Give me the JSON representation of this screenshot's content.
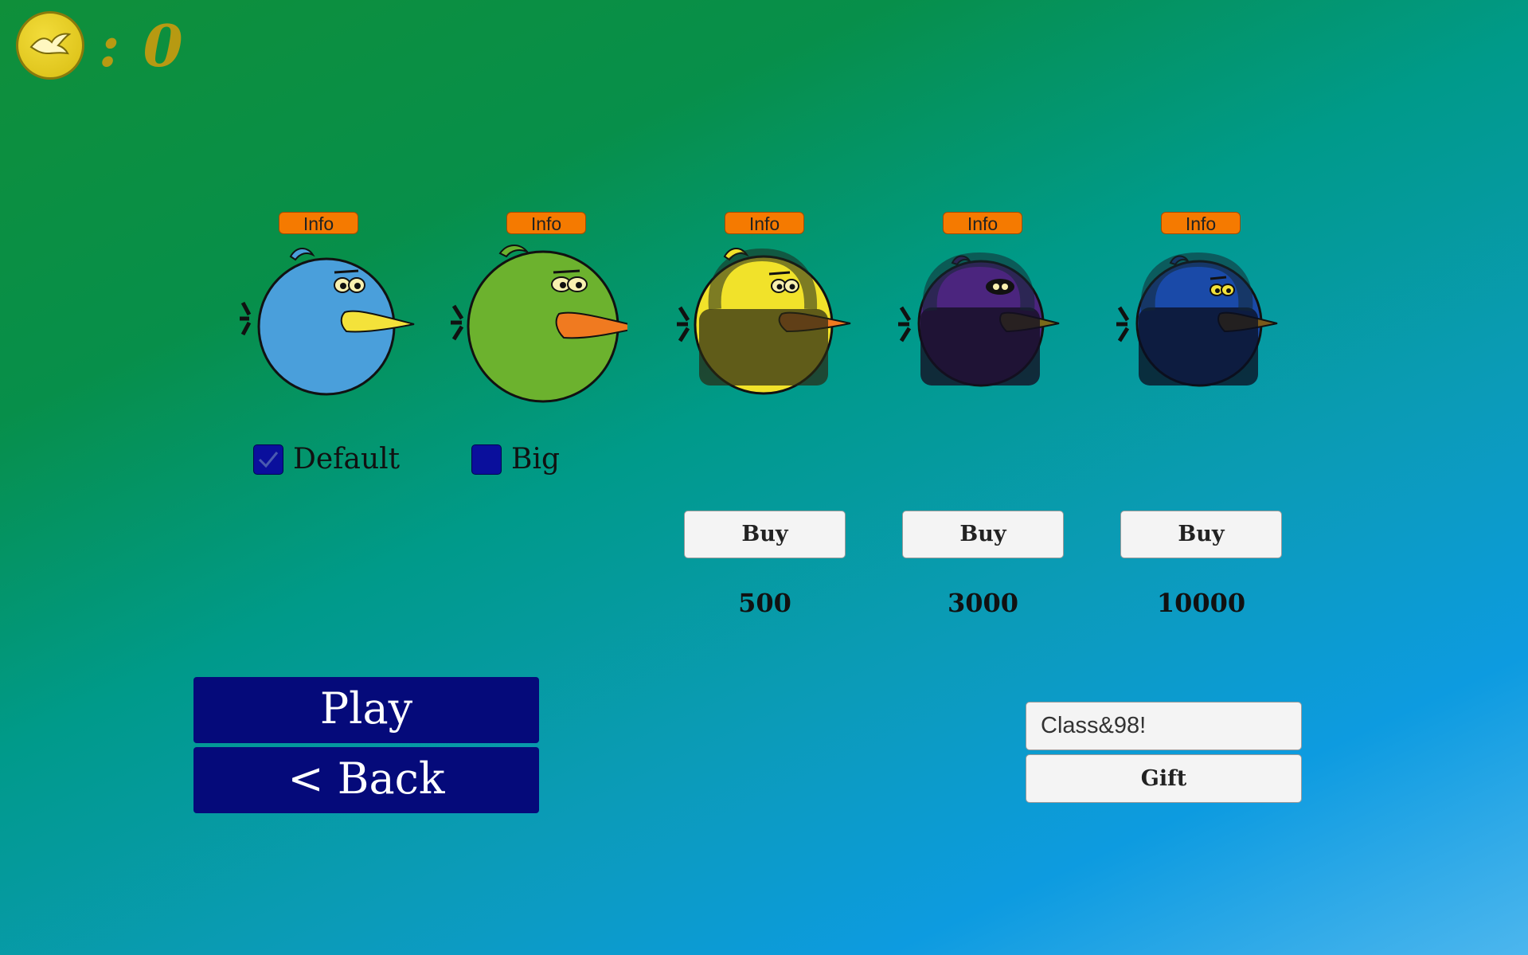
{
  "coins": {
    "icon": "dove-coin-icon",
    "label": ": 0"
  },
  "birds": [
    {
      "name": "Default",
      "info_label": "Info",
      "color": "#4a9fdb",
      "beak": "#f4e23a",
      "owned": true,
      "selected": true
    },
    {
      "name": "Big",
      "info_label": "Info",
      "color": "#6cb22e",
      "beak": "#f07a20",
      "owned": true,
      "selected": false
    },
    {
      "info_label": "Info",
      "color": "#f1e22a",
      "beak": "#f07a20",
      "owned": false,
      "buy_label": "Buy",
      "price": "500"
    },
    {
      "info_label": "Info",
      "color": "#4b257e",
      "beak": "#7a6a1a",
      "owned": false,
      "buy_label": "Buy",
      "price": "3000"
    },
    {
      "info_label": "Info",
      "color": "#1a4aa8",
      "beak": "#7a5a1a",
      "owned": false,
      "buy_label": "Buy",
      "price": "10000"
    }
  ],
  "menu": {
    "play_label": "Play",
    "back_label": "< Back"
  },
  "gift": {
    "input_value": "Class&98!",
    "button_label": "Gift"
  },
  "colors": {
    "info_button": "#f57a00",
    "nav_button": "#050a7a",
    "checkbox": "#0a0f9c",
    "coin": "#e6cc22"
  }
}
